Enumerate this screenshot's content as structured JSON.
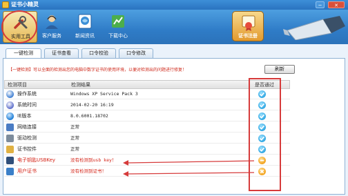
{
  "window": {
    "title": "证书小精灵",
    "min_label": "─",
    "close_label": "✕"
  },
  "toolbar": {
    "items": [
      {
        "label": "实用工具",
        "icon": "tools-icon"
      },
      {
        "label": "客户服务",
        "icon": "customer-service-icon"
      },
      {
        "label": "新闻资讯",
        "icon": "news-icon"
      },
      {
        "label": "下载中心",
        "icon": "download-icon"
      }
    ],
    "cert_register_label": "证书注册"
  },
  "tabs": [
    {
      "label": "一键检测",
      "active": true
    },
    {
      "label": "证书查看",
      "active": false
    },
    {
      "label": "口令校验",
      "active": false
    },
    {
      "label": "口令修改",
      "active": false
    }
  ],
  "notice": "【一键检测】可以全面的检测出您的电脑中数字证书的使用环境，以便对检测出的问题进行修复！",
  "refresh_label": "刷新",
  "table": {
    "headers": [
      "检测项目",
      "检测结果",
      "是否通过"
    ],
    "rows": [
      {
        "name": "操作系统",
        "value": "Windows XP Service Pack 3",
        "status": "pass",
        "icon": "os-icon"
      },
      {
        "name": "系统时间",
        "value": "2014-02-20 16:19",
        "status": "pass",
        "icon": "clock-icon"
      },
      {
        "name": "IE版本",
        "value": "8.0.6001.18702",
        "status": "pass",
        "icon": "ie-icon"
      },
      {
        "name": "网络连接",
        "value": "正常",
        "status": "pass",
        "icon": "network-icon"
      },
      {
        "name": "驱动检测",
        "value": "正常",
        "status": "pass",
        "icon": "driver-icon"
      },
      {
        "name": "证书控件",
        "value": "正常",
        "status": "pass",
        "icon": "control-icon"
      },
      {
        "name": "电子钥匙USBKey",
        "value": "没有检测到usb key！",
        "status": "fail",
        "icon": "usbkey-icon"
      },
      {
        "name": "用户证书",
        "value": "没有检测到证书！",
        "status": "fail",
        "icon": "user-cert-icon"
      }
    ]
  },
  "colors": {
    "accent": "#2f7cc7",
    "error": "#d42418",
    "highlight": "#d63a3a",
    "pass": "#2ea6e2",
    "fail": "#f2a21e"
  }
}
